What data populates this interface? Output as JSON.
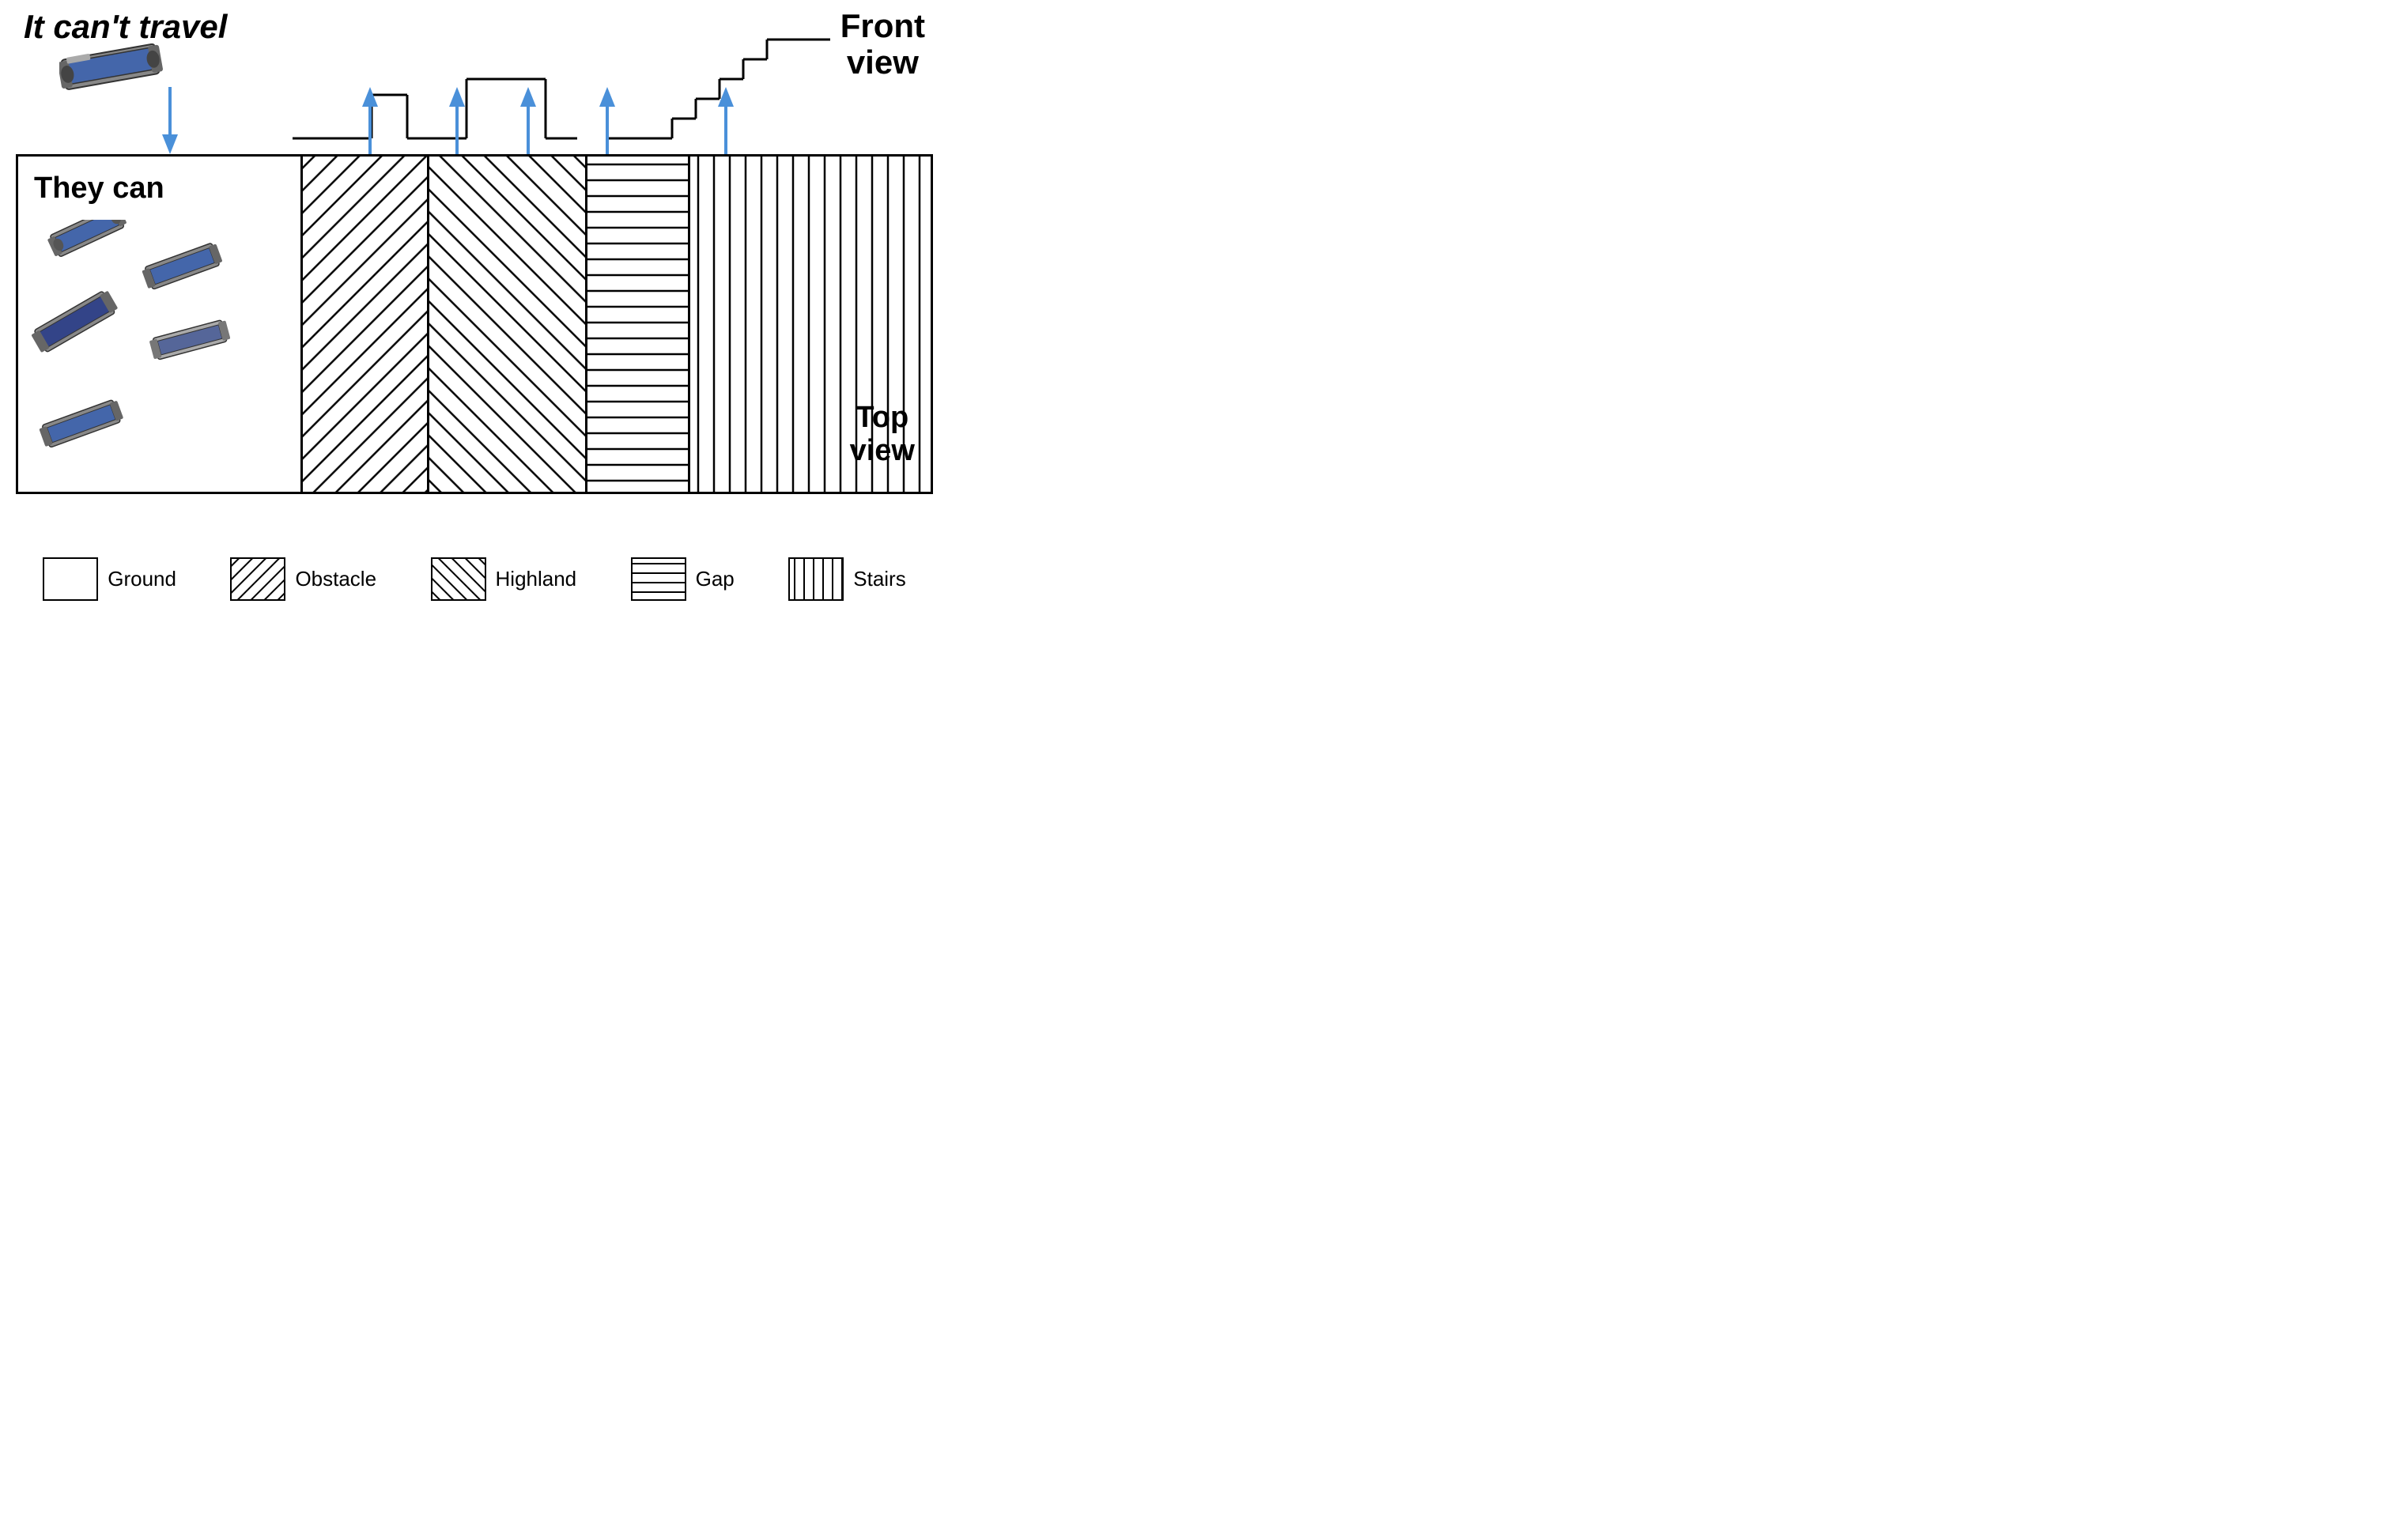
{
  "title": {
    "cant_travel": "It can't travel",
    "front_view": "Front\nview",
    "top_view": "Top\nview",
    "they_can": "They\ncan"
  },
  "legend": {
    "items": [
      {
        "id": "ground",
        "label": "Ground",
        "pattern": "none"
      },
      {
        "id": "obstacle",
        "label": "Obstacle",
        "pattern": "diagonal-forward"
      },
      {
        "id": "highland",
        "label": "Highland",
        "pattern": "diagonal-back"
      },
      {
        "id": "gap",
        "label": "Gap",
        "pattern": "horizontal"
      },
      {
        "id": "stairs",
        "label": "Stairs",
        "pattern": "vertical"
      }
    ]
  },
  "colors": {
    "arrow": "#4a90d9",
    "border": "#000000"
  }
}
